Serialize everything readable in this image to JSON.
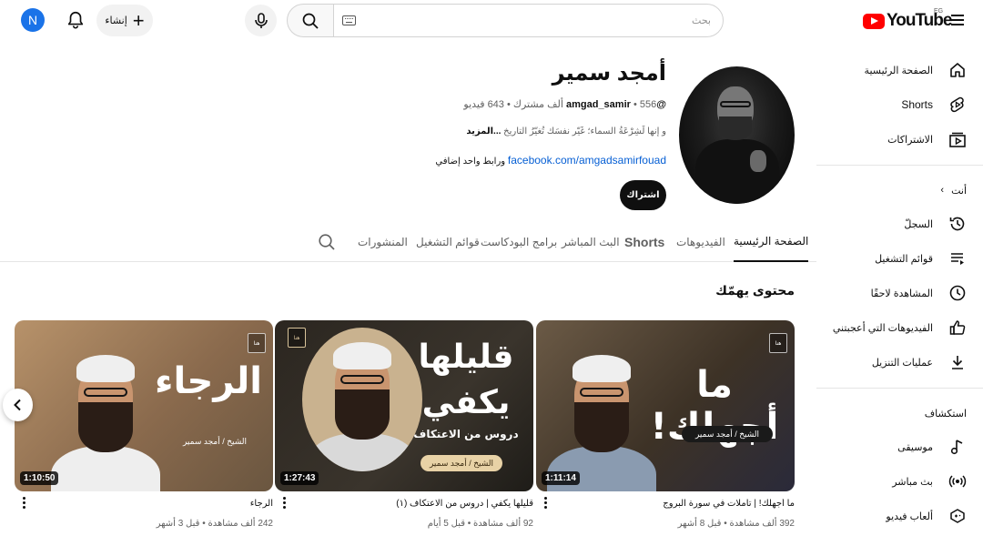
{
  "header": {
    "avatar_letter": "N",
    "create_label": "إنشاء",
    "search_placeholder": "بحث",
    "logo_text": "YouTube",
    "country_code": "EG"
  },
  "sidebar": {
    "main": [
      {
        "label": "الصفحة الرئيسية",
        "icon": "home-icon"
      },
      {
        "label": "Shorts",
        "icon": "shorts-icon"
      },
      {
        "label": "الاشتراكات",
        "icon": "subscriptions-icon"
      }
    ],
    "you_heading": "أنت",
    "you": [
      {
        "label": "السجلّ",
        "icon": "history-icon"
      },
      {
        "label": "قوائم التشغيل",
        "icon": "playlists-icon"
      },
      {
        "label": "المشاهدة لاحقًا",
        "icon": "watch-later-icon"
      },
      {
        "label": "الفيديوهات التي أعجبتني",
        "icon": "like-icon"
      },
      {
        "label": "عمليات التنزيل",
        "icon": "download-icon"
      }
    ],
    "explore_heading": "استكشاف",
    "explore": [
      {
        "label": "موسيقى",
        "icon": "music-icon"
      },
      {
        "label": "بث مباشر",
        "icon": "live-icon"
      },
      {
        "label": "ألعاب فيديو",
        "icon": "gaming-icon"
      }
    ]
  },
  "channel": {
    "name": "أمجد سمير",
    "handle": "@amgad_samir",
    "subscribers": "556 ألف مشترك",
    "videos_count": "643 فيديو",
    "description": "و إنها لَشِرْعَةُ السماء؛ غَيّر نفسَك تُغيّرُ التاريخ",
    "more_label": "...المزيد",
    "link_text": "facebook.com/amgadsamirfouad",
    "extra_links": "ورابط واحد إضافي",
    "subscribe_label": "اشتراك"
  },
  "tabs": [
    {
      "label": "الصفحة الرئيسية",
      "active": true
    },
    {
      "label": "الفيديوهات",
      "active": false
    },
    {
      "label": "Shorts",
      "active": false
    },
    {
      "label": "البث المباشر",
      "active": false
    },
    {
      "label": "برامج البودكاست",
      "active": false
    },
    {
      "label": "قوائم التشغيل",
      "active": false
    },
    {
      "label": "المنشورات",
      "active": false
    }
  ],
  "section": {
    "title": "محتوى يهمّك"
  },
  "videos": [
    {
      "thumb_text": "ما أجهلك!",
      "thumb_ribbon": "الشيخ / أمجد سمير",
      "duration": "1:11:14",
      "title": "ما أجهلك! | تأملات في سورة البروج",
      "meta": "392 ألف مشاهدة • قبل 8 أشهر"
    },
    {
      "thumb_text_1": "قليلها",
      "thumb_text_2": "يكفي",
      "thumb_sub": "دروس من الاعتكاف",
      "thumb_ribbon": "الشيخ / أمجد سمير",
      "duration": "1:27:43",
      "title": "قليلها يكفي | دروس من الاعتكاف (١)",
      "meta": "92 ألف مشاهدة • قبل 5 أيام"
    },
    {
      "thumb_text": "الرجاء",
      "thumb_ribbon": "الشيخ / أمجد سمير",
      "duration": "1:10:50",
      "title": "الرجاء",
      "meta": "242 ألف مشاهدة • قبل 3 أشهر"
    }
  ],
  "thumb_badge": "هنا"
}
